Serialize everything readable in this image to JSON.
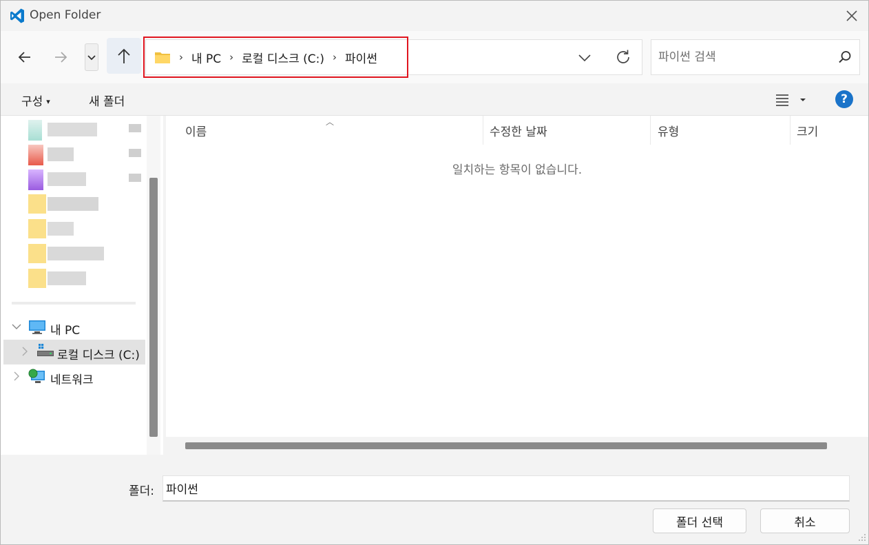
{
  "window": {
    "title": "Open Folder",
    "app_icon": "vscode-icon",
    "close_icon": "close-icon"
  },
  "nav": {
    "back_icon": "back-arrow-icon",
    "forward_icon": "forward-arrow-icon",
    "recent_icon": "chevron-down-icon",
    "up_icon": "up-arrow-icon"
  },
  "address": {
    "crumbs": [
      "내 PC",
      "로컬 디스크 (C:)",
      "파이썬"
    ],
    "separator": "›",
    "folder_icon": "folder-icon",
    "dropdown_icon": "chevron-down-icon",
    "refresh_icon": "refresh-icon"
  },
  "search": {
    "placeholder": "파이썬 검색",
    "value": "",
    "icon": "search-icon"
  },
  "toolbar": {
    "organize_label": "구성",
    "organize_caret": "▾",
    "new_folder_label": "새 폴더",
    "view_icon": "view-options-icon",
    "help_icon": "help-icon",
    "help_glyph": "?"
  },
  "sidebar": {
    "items": [
      {
        "label": "내 PC",
        "icon": "computer-icon",
        "expanded": true
      },
      {
        "label": "로컬 디스크 (C:)",
        "icon": "drive-icon",
        "selected": true
      },
      {
        "label": "네트워크",
        "icon": "network-icon"
      }
    ]
  },
  "columns": {
    "name": "이름",
    "modified": "수정한 날짜",
    "type": "유형",
    "size": "크기"
  },
  "content": {
    "empty_message": "일치하는 항목이 없습니다."
  },
  "footer": {
    "folder_label": "폴더:",
    "folder_value": "파이썬",
    "select_button": "폴더 선택",
    "cancel_button": "취소"
  },
  "colors": {
    "highlight_border": "#e0141e",
    "help_blue": "#1a73c9",
    "vscode_blue": "#0a7acc"
  }
}
